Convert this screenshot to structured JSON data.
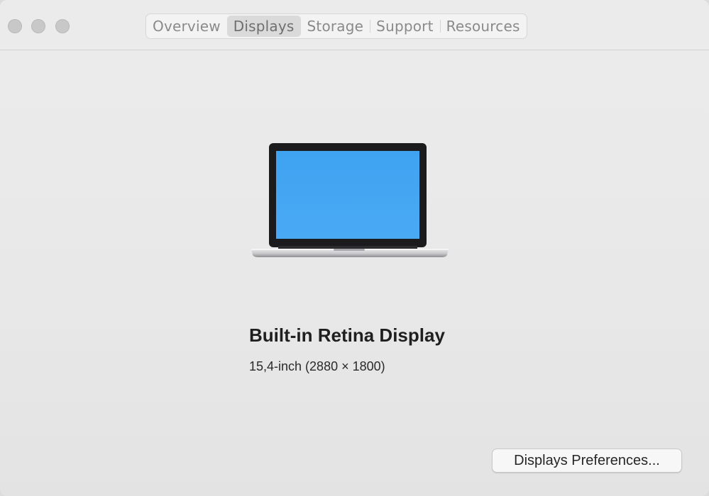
{
  "window": {
    "tabs": [
      {
        "label": "Overview",
        "selected": false
      },
      {
        "label": "Displays",
        "selected": true
      },
      {
        "label": "Storage",
        "selected": false
      },
      {
        "label": "Support",
        "selected": false
      },
      {
        "label": "Resources",
        "selected": false
      }
    ]
  },
  "display": {
    "name": "Built-in Retina Display",
    "spec": "15,4-inch (2880 × 1800)",
    "icon": "laptop-display-icon",
    "screen_color": "#43a6f2"
  },
  "actions": {
    "preferences_label": "Displays Preferences..."
  },
  "colors": {
    "window_background": "#e8e8e8",
    "selected_tab": "#dadada"
  }
}
